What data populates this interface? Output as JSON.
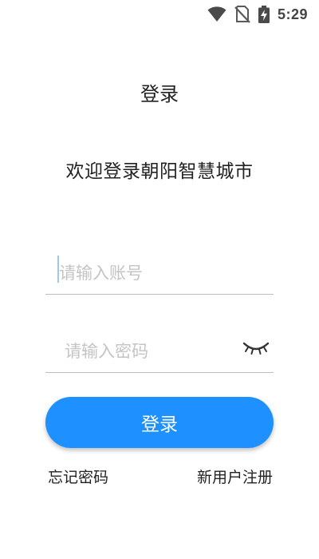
{
  "status_bar": {
    "time": "5:29",
    "icons": [
      "wifi-icon",
      "no-sim-icon",
      "battery-charging-icon"
    ]
  },
  "header": {
    "title": "登录"
  },
  "welcome": {
    "text": "欢迎登录朝阳智慧城市"
  },
  "form": {
    "account": {
      "value": "",
      "placeholder": "请输入账号"
    },
    "password": {
      "value": "",
      "placeholder": "请输入密码",
      "toggle_icon": "eye-closed-icon"
    },
    "login_label": "登录"
  },
  "links": {
    "forgot_password": "忘记密码",
    "register": "新用户注册"
  },
  "colors": {
    "accent": "#1e90ff",
    "placeholder": "#c4c4c4",
    "divider": "#bdbdbd"
  }
}
